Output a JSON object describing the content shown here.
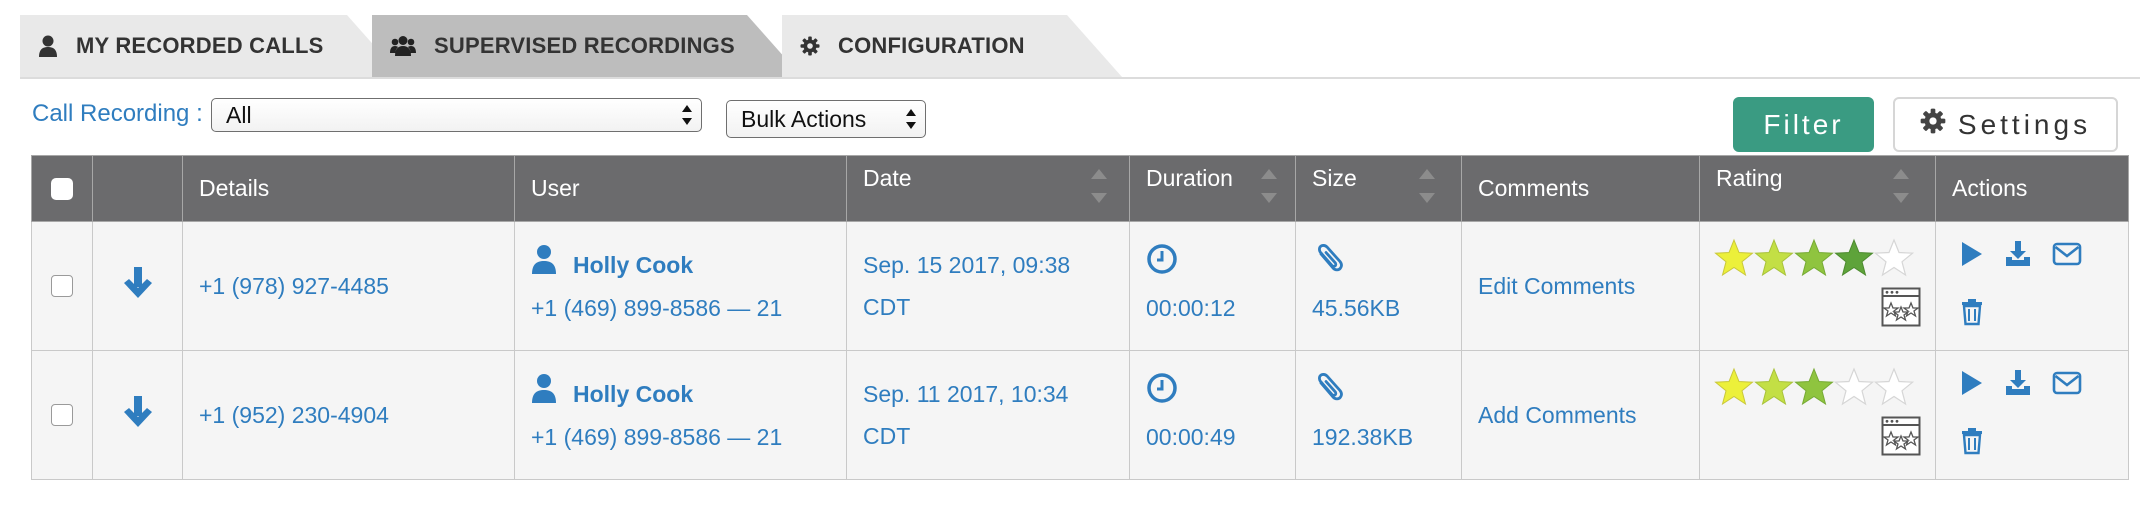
{
  "tabs": [
    {
      "label": "MY RECORDED CALLS",
      "icon": "user-icon",
      "active": false
    },
    {
      "label": "SUPERVISED RECORDINGS",
      "icon": "users-icon",
      "active": true
    },
    {
      "label": "CONFIGURATION",
      "icon": "gear-icon",
      "active": false
    }
  ],
  "toolbar": {
    "call_recording_label": "Call Recording :",
    "call_recording_value": "All",
    "bulk_actions_value": "Bulk Actions",
    "filter_label": "Filter",
    "settings_label": "Settings"
  },
  "table": {
    "headers": {
      "details": "Details",
      "user": "User",
      "date": "Date",
      "duration": "Duration",
      "size": "Size",
      "comments": "Comments",
      "rating": "Rating",
      "actions": "Actions"
    },
    "rows": [
      {
        "details": "+1 (978) 927-4485",
        "user_name": "Holly Cook",
        "user_ext": "+1 (469) 899-8586 — 21",
        "date_line1": "Sep. 15 2017, 09:38",
        "date_line2": "CDT",
        "duration": "00:00:12",
        "size": "45.56KB",
        "comments": "Edit Comments",
        "rating": 4
      },
      {
        "details": "+1 (952) 230-4904",
        "user_name": "Holly Cook",
        "user_ext": "+1 (469) 899-8586 — 21",
        "date_line1": "Sep. 11 2017, 10:34",
        "date_line2": "CDT",
        "duration": "00:00:49",
        "size": "192.38KB",
        "comments": "Add Comments",
        "rating": 3
      }
    ]
  },
  "colors": {
    "link": "#2f7dbf",
    "header_bg": "#6b6b6d",
    "filter_bg": "#3a9b82",
    "active_tab_bg": "#bdbdbd",
    "inactive_tab_bg": "#e9e9e9"
  }
}
